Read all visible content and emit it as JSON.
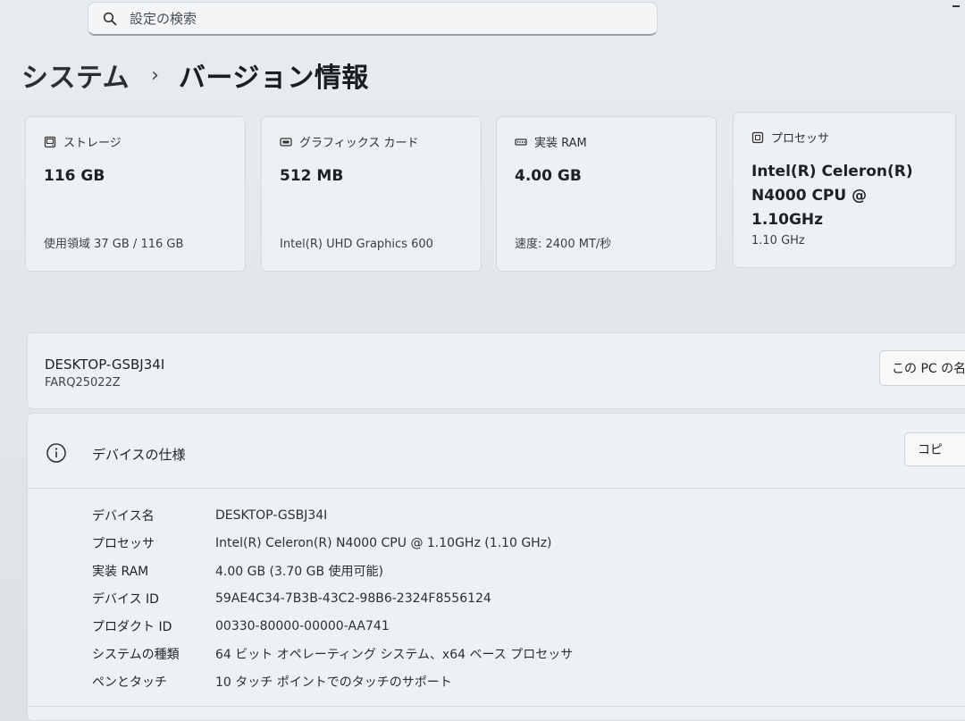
{
  "search": {
    "placeholder": "設定の検索"
  },
  "breadcrumb": {
    "parent": "システム",
    "separator": "›",
    "current": "バージョン情報"
  },
  "cards": [
    {
      "icon": "storage-icon",
      "label": "ストレージ",
      "value": "116 GB",
      "sub": "使用領域 37 GB / 116 GB"
    },
    {
      "icon": "graphics-card-icon",
      "label": "グラフィックス カード",
      "value": "512 MB",
      "sub": "Intel(R) UHD Graphics 600"
    },
    {
      "icon": "ram-icon",
      "label": "実装 RAM",
      "value": "4.00 GB",
      "sub": "速度: 2400 MT/秒"
    },
    {
      "icon": "processor-icon",
      "label": "プロセッサ",
      "value_line1": "Intel(R) Celeron(R)",
      "value_line2": "N4000 CPU @ 1.10GHz",
      "sub": "1.10 GHz"
    }
  ],
  "device": {
    "name": "DESKTOP-GSBJ34I",
    "model": "FARQ25022Z",
    "rename_button": "この PC の名"
  },
  "specs": {
    "icon": "info-icon",
    "title": "デバイスの仕様",
    "copy_button": "コピ",
    "rows": [
      {
        "label": "デバイス名",
        "value": "DESKTOP-GSBJ34I"
      },
      {
        "label": "プロセッサ",
        "value": "Intel(R) Celeron(R) N4000 CPU @ 1.10GHz (1.10 GHz)"
      },
      {
        "label": "実装 RAM",
        "value": "4.00 GB (3.70 GB 使用可能)"
      },
      {
        "label": "デバイス ID",
        "value": "59AE4C34-7B3B-43C2-98B6-2324F8556124"
      },
      {
        "label": "プロダクト ID",
        "value": "00330-80000-00000-AA741"
      },
      {
        "label": "システムの種類",
        "value": "64 ビット オペレーティング システム、x64 ベース プロセッサ"
      },
      {
        "label": "ペンとタッチ",
        "value": "10 タッチ ポイントでのタッチのサポート"
      }
    ]
  }
}
